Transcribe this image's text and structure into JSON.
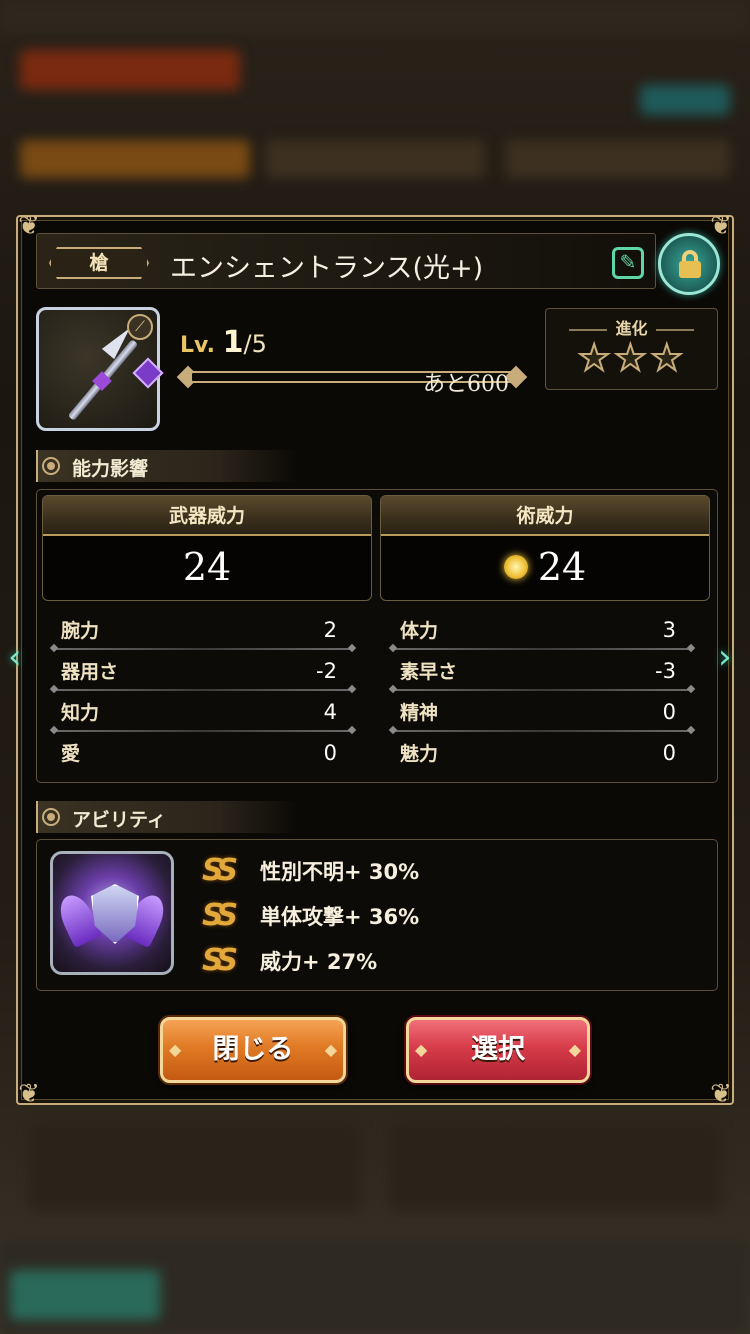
{
  "header": {
    "weapon_type": "槍",
    "weapon_name": "エンシェントランス(光+)",
    "edit_icon": "edit-icon",
    "lock_icon": "lock-icon"
  },
  "level": {
    "prefix": "Lv.",
    "current": "1",
    "max": "/5",
    "exp_remaining": "あと600",
    "exp_progress": 0
  },
  "evolution": {
    "title": "進化",
    "stars_filled": 0,
    "stars_total": 3
  },
  "ability_influence": {
    "section_label": "能力影響",
    "weapon_power_label": "武器威力",
    "weapon_power": "24",
    "arts_power_label": "術威力",
    "arts_power": "24",
    "stats_left": [
      {
        "label": "腕力",
        "value": "2"
      },
      {
        "label": "器用さ",
        "value": "-2"
      },
      {
        "label": "知力",
        "value": "4"
      },
      {
        "label": "愛",
        "value": "0"
      }
    ],
    "stats_right": [
      {
        "label": "体力",
        "value": "3"
      },
      {
        "label": "素早さ",
        "value": "-3"
      },
      {
        "label": "精神",
        "value": "0"
      },
      {
        "label": "魅力",
        "value": "0"
      }
    ]
  },
  "abilities": {
    "section_label": "アビリティ",
    "items": [
      {
        "mark": "SS",
        "text": "性別不明+ 30%"
      },
      {
        "mark": "SS",
        "text": "単体攻撃+ 36%"
      },
      {
        "mark": "SS",
        "text": "威力+ 27%"
      }
    ]
  },
  "buttons": {
    "close_label": "閉じる",
    "select_label": "選択"
  },
  "colors": {
    "gold_border": "#c8ad7a",
    "teal_accent": "#5fd6a6",
    "close_button": "#e07a24",
    "select_button": "#d83c4a"
  }
}
